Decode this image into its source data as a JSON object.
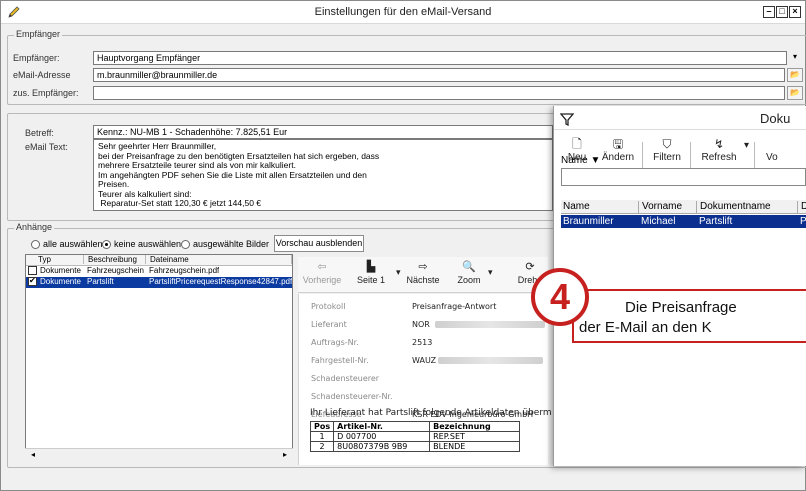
{
  "window": {
    "title": "Einstellungen für den eMail-Versand"
  },
  "recipient_group": {
    "title": "Empfänger",
    "empfaenger_label": "Empfänger:",
    "empfaenger_value": "Hauptvorgang Empfänger",
    "email_label": "eMail-Adresse",
    "email_value": "m.braunmiller@braunmiller.de",
    "zus_label": "zus. Empfänger:",
    "zus_value": ""
  },
  "message": {
    "betreff_label": "Betreff:",
    "betreff_value": "Kennz.: NU-MB 1 - Schadenhöhe: 7.825,51 Eur",
    "text_label": "eMail Text:",
    "text_lines": "Sehr geehrter Herr Braunmiller,\nbei der Preisanfrage zu den benötigten Ersatzteilen hat sich ergeben, dass\nmehrere Ersatzteile teurer sind als von mir kalkuliert.\nIm angehängten PDF sehen Sie die Liste mit allen Ersatzteilen und den\nPreisen.\nTeurer als kalkuliert sind:\n Reparatur-Set statt 120,30 € jetzt 144,50 €"
  },
  "attachments": {
    "title": "Anhänge",
    "opt_all": "alle auswählen",
    "opt_none": "keine auswählen",
    "opt_images": "ausgewählte Bilder",
    "preview_button": "Vorschau ausblenden",
    "columns": [
      "Typ",
      "Beschreibung",
      "Dateiname"
    ],
    "rows": [
      {
        "typ": "Dokumente",
        "beschreibung": "Fahrzeugschein",
        "datei": "Fahrzeugschein.pdf",
        "checked": false
      },
      {
        "typ": "Dokumente",
        "beschreibung": "Partslift",
        "datei": "PartsliftPricerequestResponse42847.pdf",
        "checked": true
      }
    ]
  },
  "pdf_viewer": {
    "prev": "Vorherige",
    "page": "Seite 1",
    "next": "Nächste",
    "zoom": "Zoom",
    "rotate": "Drehe",
    "fields": [
      {
        "k": "Protokoll",
        "v": "Preisanfrage-Antwort"
      },
      {
        "k": "Lieferant",
        "v": "NOR"
      },
      {
        "k": "Auftrags-Nr.",
        "v": "2513"
      },
      {
        "k": "Fahrgestell-Nr.",
        "v": "WAUZ"
      },
      {
        "k": "Schadensteuerer",
        "v": ""
      },
      {
        "k": "Schadensteuerer-Nr.",
        "v": ""
      },
      {
        "k": "Liefeadresse",
        "v": "KSR EDV-Ingenieurbüro GmbH"
      }
    ],
    "intro": "Ihr Lieferant hat Partslift folgende Artikeldaten überm",
    "table_head": [
      "Pos",
      "Artikel-Nr.",
      "Bezeichnung"
    ],
    "table_rows": [
      [
        "1",
        "D 007700",
        "REP.SET"
      ],
      [
        "2",
        "8U0807379B 9B9",
        "BLENDE"
      ]
    ]
  },
  "doc_panel": {
    "title": "Doku",
    "tools": [
      "Neu",
      "Ändern",
      "Filtern",
      "Refresh",
      "Vo"
    ],
    "sort_label": "Name ▼",
    "columns": [
      "Name",
      "Vorname",
      "Dokumentname",
      "D"
    ],
    "row": [
      "Braunmiller",
      "Michael",
      "Partslift",
      "P"
    ]
  },
  "callout": {
    "number": "4",
    "line1": "Die Preisanfrage",
    "line2": "der E-Mail an den K"
  },
  "colors": {
    "accent_red": "#c6211e",
    "selection_blue": "#0b3aa0"
  }
}
